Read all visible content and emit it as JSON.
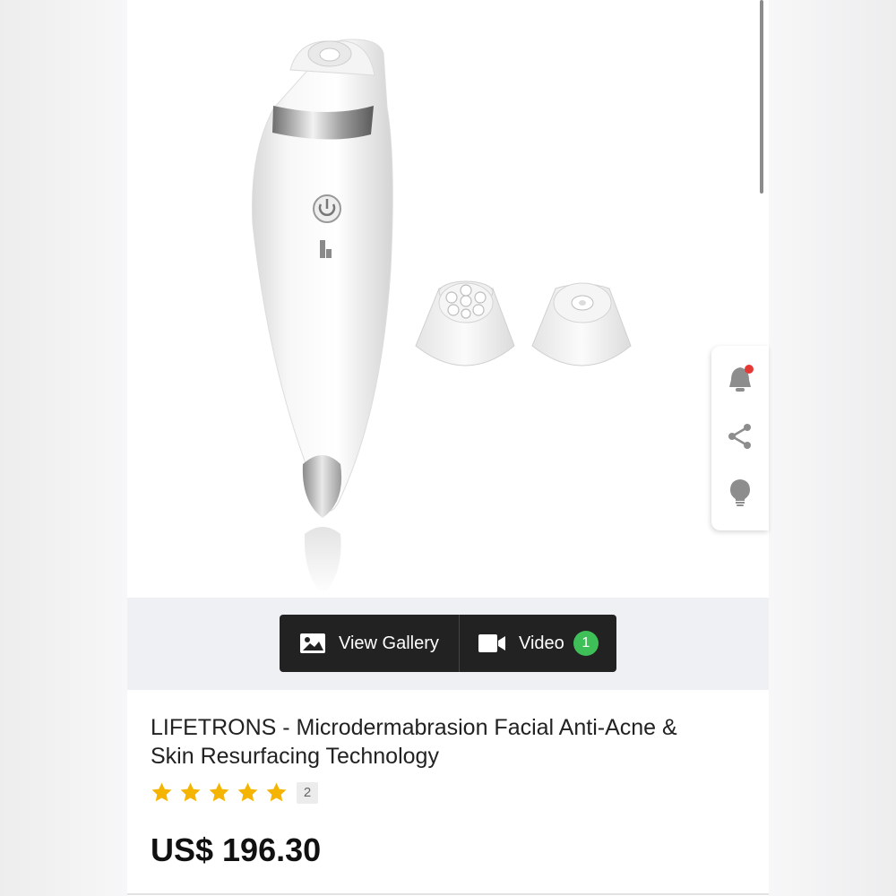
{
  "media": {
    "view_gallery_label": "View Gallery",
    "video_label": "Video",
    "video_count": "1"
  },
  "product": {
    "title": "LIFETRONS - Microdermabrasion Facial Anti-Acne & Skin Resurfacing Technology",
    "rating_stars": 5,
    "review_count": "2",
    "price": "US$ 196.30"
  },
  "side_actions": [
    "bell-icon",
    "share-icon",
    "lightbulb-icon"
  ],
  "colors": {
    "star": "#f5b400",
    "badge": "#3fbf57",
    "notification_dot": "#e53935",
    "media_bar": "#222222"
  }
}
